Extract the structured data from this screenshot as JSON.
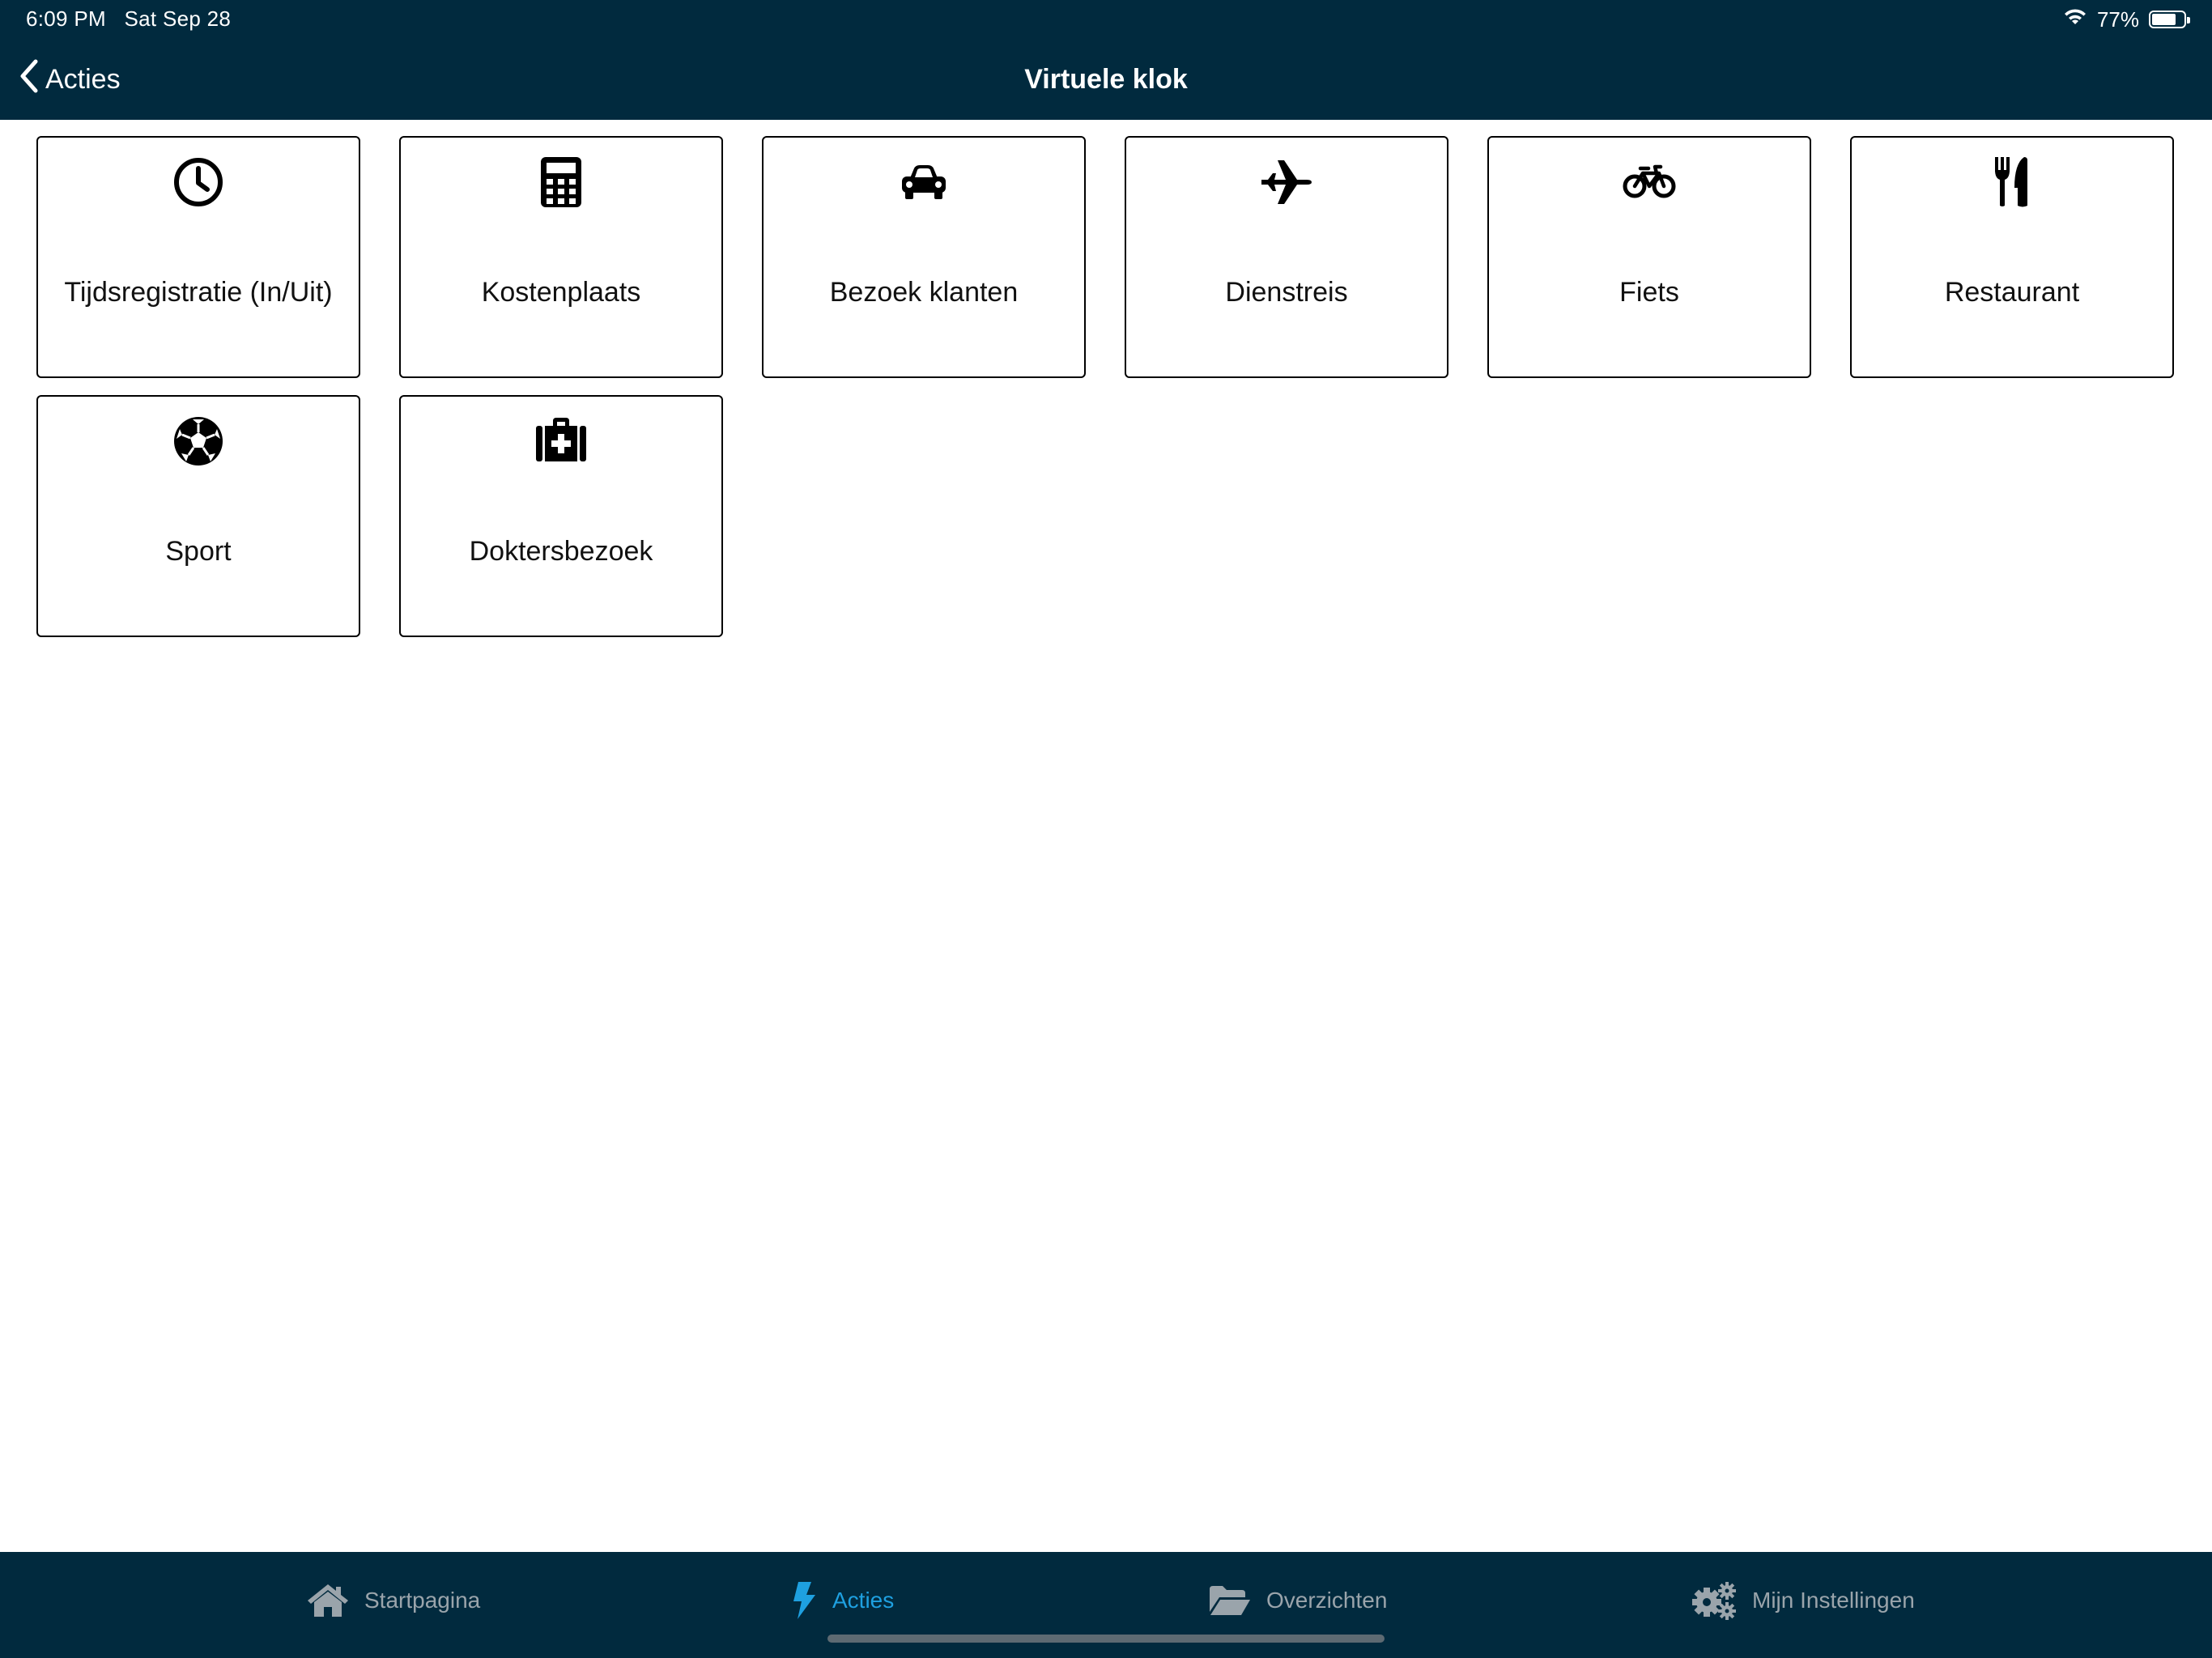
{
  "status_bar": {
    "time": "6:09 PM",
    "date": "Sat Sep 28",
    "battery_text": "77%",
    "battery_level": 0.77
  },
  "nav": {
    "back_label": "Acties",
    "title": "Virtuele klok"
  },
  "tiles": [
    {
      "label": "Tijdsregistratie (In/Uit)",
      "icon": "clock-icon"
    },
    {
      "label": "Kostenplaats",
      "icon": "calculator-icon"
    },
    {
      "label": "Bezoek klanten",
      "icon": "car-icon"
    },
    {
      "label": "Dienstreis",
      "icon": "airplane-icon"
    },
    {
      "label": "Fiets",
      "icon": "bicycle-icon"
    },
    {
      "label": "Restaurant",
      "icon": "utensils-icon"
    },
    {
      "label": "Sport",
      "icon": "soccer-ball-icon"
    },
    {
      "label": "Doktersbezoek",
      "icon": "medkit-icon"
    }
  ],
  "tabbar": {
    "tabs": [
      {
        "label": "Startpagina",
        "icon": "home-icon",
        "active": false
      },
      {
        "label": "Acties",
        "icon": "lightning-icon",
        "active": true
      },
      {
        "label": "Overzichten",
        "icon": "folder-open-icon",
        "active": false
      },
      {
        "label": "Mijn Instellingen",
        "icon": "gears-icon",
        "active": false
      }
    ]
  },
  "colors": {
    "header_bg": "#012a3e",
    "active_tab": "#1ea0e0",
    "inactive_tab": "#9aa4ab"
  }
}
